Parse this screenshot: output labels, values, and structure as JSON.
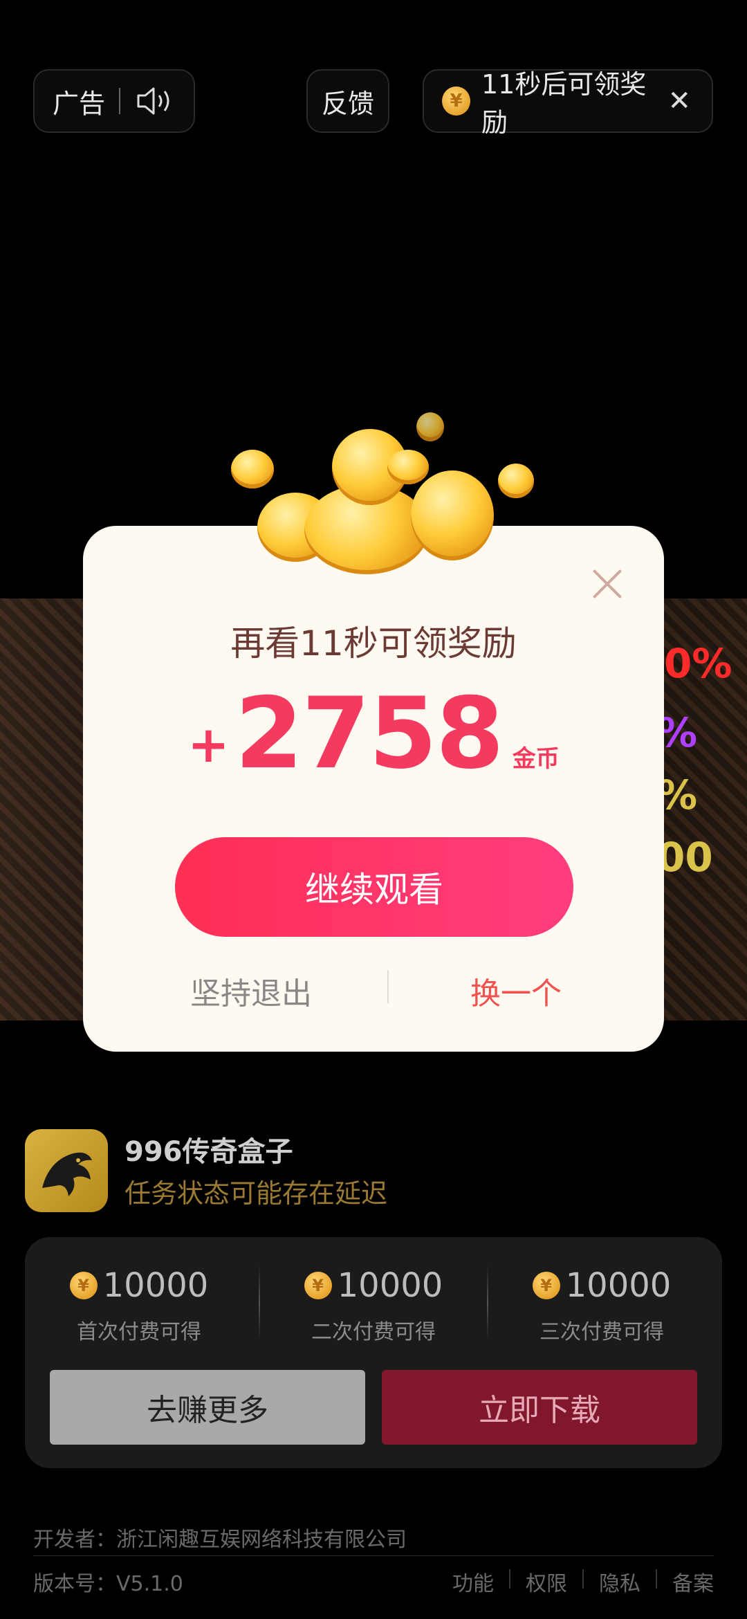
{
  "topbar": {
    "ad_label": "广告",
    "feedback_label": "反馈",
    "timer_text": "11秒后可领奖励",
    "coin_symbol": "¥"
  },
  "background": {
    "stat_1": "0%",
    "stat_2": "%",
    "stat_3": "%",
    "stat_4": "00"
  },
  "modal": {
    "headline": "再看11秒可领奖励",
    "plus": "+",
    "amount": "2758",
    "unit": "金币",
    "continue_label": "继续观看",
    "quit_label": "坚持退出",
    "switch_label": "换一个",
    "accent_color": "#f43b5f"
  },
  "app": {
    "name": "996传奇盒子",
    "subtitle": "任务状态可能存在延迟"
  },
  "rewards": [
    {
      "amount": "10000",
      "label": "首次付费可得"
    },
    {
      "amount": "10000",
      "label": "二次付费可得"
    },
    {
      "amount": "10000",
      "label": "三次付费可得"
    }
  ],
  "actions": {
    "earn_more": "去赚更多",
    "download": "立即下载"
  },
  "footer": {
    "developer": "开发者：浙江闲趣互娱网络科技有限公司",
    "version": "版本号：V5.1.0",
    "links": [
      "功能",
      "权限",
      "隐私",
      "备案"
    ]
  }
}
